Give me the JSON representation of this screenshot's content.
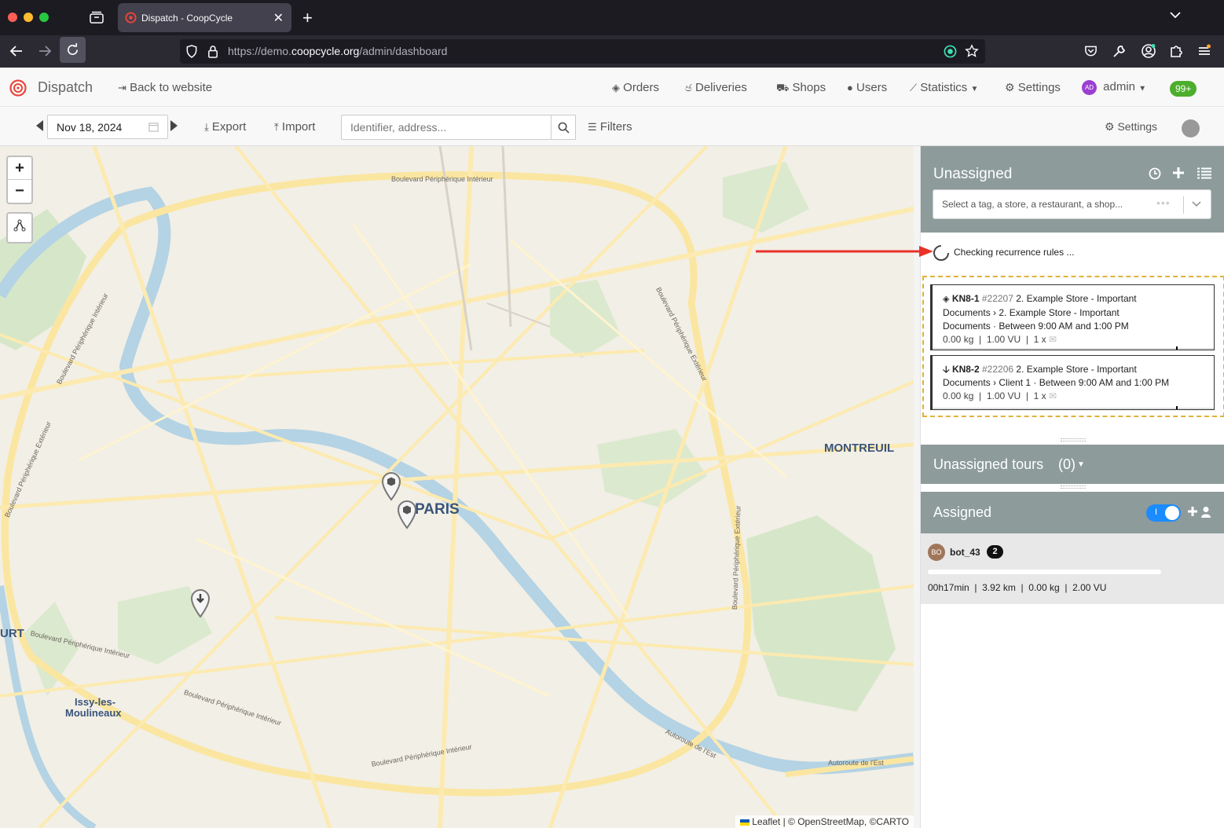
{
  "browser": {
    "tab_title": "Dispatch - CoopCycle",
    "url_prefix": "https://demo.",
    "url_domain": "coopcycle.org",
    "url_path": "/admin/dashboard"
  },
  "nav": {
    "brand": "Dispatch",
    "back": "Back to website",
    "orders": "Orders",
    "deliveries": "Deliveries",
    "shops": "Shops",
    "users": "Users",
    "statistics": "Statistics",
    "settings": "Settings",
    "avatar": "AD",
    "user": "admin",
    "badge": "99+"
  },
  "toolbar": {
    "date": "Nov 18, 2024",
    "export": "Export",
    "import": "Import",
    "search_placeholder": "Identifier, address...",
    "filters": "Filters",
    "settings": "Settings"
  },
  "map": {
    "labels": {
      "paris": "PARIS",
      "montreuil": "MONTREUIL",
      "issy1": "Issy-les-",
      "issy2": "Moulineaux",
      "urt": "URT",
      "bp_top": "Boulevard Périphérique Intérieur",
      "bp_left": "Boulevard Périphérique Intérieur",
      "bp_left2": "Boulevard Périphérique Extérieur",
      "bp_right": "Boulevard Périphérique Extérieur",
      "bp_right2": "Boulevard Périphérique Extérieur",
      "bp_sw": "Boulevard Périphérique Intérieur",
      "bp_sw2": "Boulevard Périphérique Intérieur",
      "bp_s": "Boulevard Périphérique Intérieur",
      "ae1": "Autoroute de l'Est",
      "ae2": "Autoroute de l'Est"
    },
    "attribution": "Leaflet | © OpenStreetMap, ©CARTO",
    "zoom_in": "+",
    "zoom_out": "−"
  },
  "sidebar": {
    "unassigned_title": "Unassigned",
    "tag_placeholder": "Select a tag, a store, a restaurant, a shop...",
    "recurrence_status": "Checking recurrence rules ...",
    "tasks": [
      {
        "code": "KN8-1",
        "number": "#22207",
        "line1_rest": "2. Example Store - Important",
        "line2": "Documents › 2. Example Store - Important",
        "line3": "Documents · Between 9:00 AM and 1:00 PM",
        "meta": "0.00 kg  |  1.00 VU  |  1 x",
        "type_icon": "package-icon"
      },
      {
        "code": "KN8-2",
        "number": "#22206",
        "line1_rest": "2. Example Store - Important",
        "line2": "Documents › Client 1 · Between 9:00 AM and 1:00 PM",
        "meta": "0.00 kg  |  1.00 VU  |  1 x",
        "type_icon": "arrow-down-icon"
      }
    ],
    "unassigned_tours": "Unassigned tours",
    "unassigned_tours_count": "(0)",
    "assigned_title": "Assigned",
    "toggle_label": "I",
    "courier": {
      "initials": "BO",
      "name": "bot_43",
      "count": "2",
      "progress": 0,
      "stats": "00h17min  |  3.92 km  |  0.00 kg  |  2.00 VU"
    }
  },
  "colors": {
    "accent_red": "#e8463b",
    "panel_grey": "#8d9b9b",
    "badge_green": "#4cae2c",
    "avatar_purple": "#9b3fd1",
    "toggle_blue": "#1a8cff",
    "dashed_border": "#e0b23a"
  }
}
